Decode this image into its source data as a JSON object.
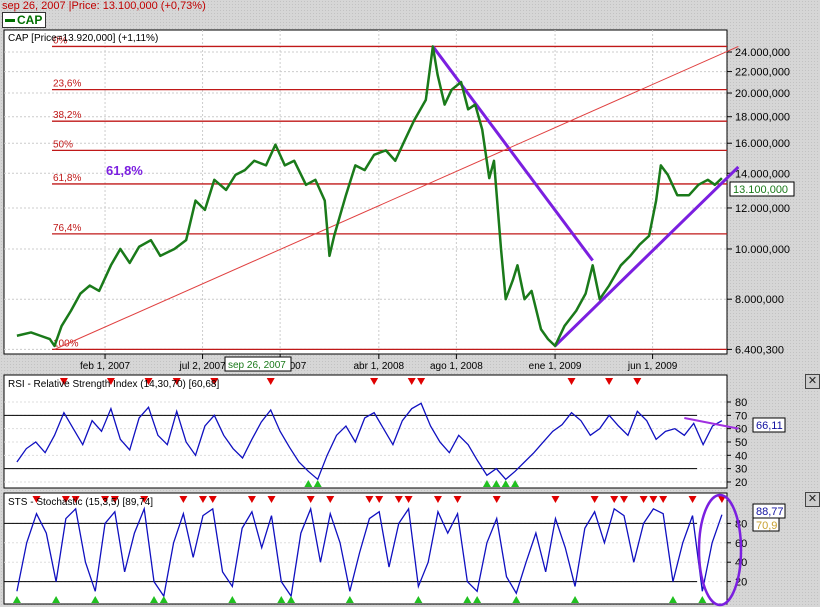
{
  "header": {
    "status": "sep 26, 2007 |Price: 13.100,000 (+0,73%)",
    "legend": "CAP"
  },
  "chart_data": [
    {
      "type": "line",
      "title": "CAP [Price=13.920,000] (+1,11%)",
      "title_prefix": "CAP [Price=",
      "title_value": "13.920,000] (+1,11%)",
      "scale": "log",
      "ylim": [
        6400300,
        24600000
      ],
      "y_ticks": [
        {
          "v": 24000000,
          "label": "24.000,000"
        },
        {
          "v": 22000000,
          "label": "22.000,000"
        },
        {
          "v": 20000000,
          "label": "20.000,000"
        },
        {
          "v": 18000000,
          "label": "18.000,000"
        },
        {
          "v": 16000000,
          "label": "16.000,000"
        },
        {
          "v": 14000000,
          "label": "14.000,000"
        },
        {
          "v": 12000000,
          "label": "12.000,000"
        },
        {
          "v": 10000000,
          "label": "10.000,000"
        },
        {
          "v": 8000000,
          "label": "8.000,000"
        },
        {
          "v": 6400300,
          "label": "6.400,300"
        }
      ],
      "x_ticks": [
        {
          "v": 2007.085,
          "label": "feb 1, 2007"
        },
        {
          "v": 2007.5,
          "label": "jul 2, 2007"
        },
        {
          "v": 2007.83,
          "label": "nov 1, 2007"
        },
        {
          "v": 2008.25,
          "label": "abr 1, 2008"
        },
        {
          "v": 2008.58,
          "label": "ago 1, 2008"
        },
        {
          "v": 2009.0,
          "label": "ene 1, 2009"
        },
        {
          "v": 2009.415,
          "label": "jun 1, 2009"
        }
      ],
      "cursor_date": "sep 26, 2007",
      "last_price": "13.100,000",
      "fibonacci": {
        "high": 24600000,
        "low": 6400300,
        "levels": [
          {
            "r": 0,
            "label": "0%"
          },
          {
            "r": 0.236,
            "label": "23,6%"
          },
          {
            "r": 0.382,
            "label": "38,2%"
          },
          {
            "r": 0.5,
            "label": "50%"
          },
          {
            "r": 0.618,
            "label": "61,8%"
          },
          {
            "r": 0.764,
            "label": "76,4%"
          },
          {
            "r": 1,
            "label": "100%"
          }
        ]
      },
      "annotation": "61,8%",
      "trendlines": [
        {
          "color": "#7b1fe0",
          "from": [
            2008.48,
            24600000
          ],
          "to": [
            2009.16,
            9500000
          ]
        },
        {
          "color": "#7b1fe0",
          "from": [
            2009.0,
            6500000
          ],
          "to": [
            2009.78,
            14400000
          ]
        },
        {
          "color": "#e04040",
          "from": [
            2006.87,
            6400300
          ],
          "to": [
            2009.78,
            24600000
          ]
        }
      ],
      "series": [
        {
          "name": "CAP",
          "color": "#1a7a1a",
          "x": [
            2006.71,
            2006.77,
            2006.81,
            2006.85,
            2006.87,
            2006.9,
            2006.94,
            2006.98,
            2007.02,
            2007.06,
            2007.11,
            2007.15,
            2007.19,
            2007.23,
            2007.28,
            2007.32,
            2007.38,
            2007.43,
            2007.47,
            2007.51,
            2007.55,
            2007.6,
            2007.64,
            2007.68,
            2007.72,
            2007.77,
            2007.81,
            2007.85,
            2007.89,
            2007.94,
            2007.98,
            2008.02,
            2008.04,
            2008.06,
            2008.11,
            2008.15,
            2008.19,
            2008.23,
            2008.28,
            2008.32,
            2008.36,
            2008.4,
            2008.45,
            2008.48,
            2008.5,
            2008.53,
            2008.56,
            2008.6,
            2008.63,
            2008.66,
            2008.69,
            2008.72,
            2008.74,
            2008.77,
            2008.79,
            2008.82,
            2008.84,
            2008.87,
            2008.9,
            2008.94,
            2008.97,
            2009.0,
            2009.04,
            2009.09,
            2009.13,
            2009.16,
            2009.19,
            2009.23,
            2009.28,
            2009.32,
            2009.36,
            2009.4,
            2009.43,
            2009.45,
            2009.48,
            2009.52,
            2009.57,
            2009.61,
            2009.65,
            2009.68,
            2009.71
          ],
          "y": [
            6.8,
            6.9,
            6.8,
            6.7,
            6.5,
            7.1,
            7.6,
            8.2,
            8.5,
            8.3,
            9.3,
            10.0,
            9.4,
            10.1,
            10.4,
            9.7,
            10.0,
            10.4,
            12.4,
            11.9,
            13.6,
            13.0,
            13.9,
            14.2,
            14.8,
            14.5,
            15.9,
            14.5,
            14.8,
            13.3,
            13.6,
            12.4,
            9.7,
            10.6,
            12.7,
            14.5,
            14.2,
            15.2,
            15.5,
            14.8,
            16.2,
            17.7,
            19.4,
            24.6,
            21.7,
            19.0,
            20.3,
            21.0,
            18.6,
            19.0,
            17.0,
            13.7,
            14.8,
            10.0,
            8.0,
            8.7,
            9.3,
            8.0,
            8.3,
            7.0,
            6.7,
            6.5,
            7.1,
            7.6,
            8.2,
            9.3,
            8.0,
            8.5,
            9.3,
            9.7,
            10.2,
            10.6,
            12.4,
            14.5,
            13.9,
            12.7,
            12.7,
            13.3,
            13.6,
            13.3,
            13.7
          ],
          "y_unit": "millions"
        }
      ]
    },
    {
      "type": "line",
      "title": "RSI - Relative Strength Index (14,30,70) [60,68]",
      "ylim": [
        15,
        95
      ],
      "y_ticks": [
        20,
        30,
        40,
        50,
        60,
        70,
        80
      ],
      "bands": [
        30,
        70
      ],
      "last_value": "66,11",
      "x_start": 2006.71,
      "x_end": 2009.71,
      "values": [
        35,
        45,
        50,
        42,
        55,
        72,
        60,
        48,
        66,
        58,
        75,
        52,
        44,
        68,
        76,
        55,
        48,
        73,
        50,
        40,
        62,
        70,
        55,
        45,
        38,
        52,
        65,
        74,
        58,
        46,
        35,
        28,
        22,
        40,
        55,
        62,
        50,
        68,
        72,
        60,
        48,
        66,
        75,
        79,
        62,
        50,
        42,
        55,
        48,
        36,
        25,
        30,
        22,
        28,
        35,
        42,
        50,
        58,
        63,
        72,
        66,
        55,
        60,
        70,
        62,
        55,
        73,
        66,
        52,
        58,
        60,
        55,
        64,
        48,
        62,
        66
      ],
      "trendline": {
        "from": [
          2009.55,
          68
        ],
        "to": [
          2009.78,
          60
        ]
      }
    },
    {
      "type": "line",
      "title": "STS - Stochastic (15,3,5) [89,74]",
      "ylim": [
        0,
        100
      ],
      "y_ticks": [
        20,
        40,
        60,
        80
      ],
      "bands": [
        20,
        80
      ],
      "last_value": "88,77",
      "signal_value": "70,9",
      "x_start": 2006.71,
      "x_end": 2009.71,
      "values": [
        10,
        60,
        90,
        70,
        20,
        85,
        95,
        40,
        10,
        80,
        92,
        30,
        70,
        95,
        20,
        5,
        60,
        90,
        45,
        88,
        95,
        30,
        15,
        75,
        92,
        55,
        88,
        20,
        5,
        70,
        95,
        40,
        90,
        60,
        10,
        50,
        85,
        92,
        35,
        80,
        95,
        15,
        40,
        92,
        70,
        90,
        20,
        10,
        60,
        85,
        25,
        8,
        40,
        70,
        30,
        85,
        55,
        15,
        75,
        92,
        60,
        95,
        88,
        40,
        80,
        95,
        90,
        20,
        60,
        88,
        10,
        60,
        89
      ],
      "signal_color": "#e0c060"
    }
  ]
}
